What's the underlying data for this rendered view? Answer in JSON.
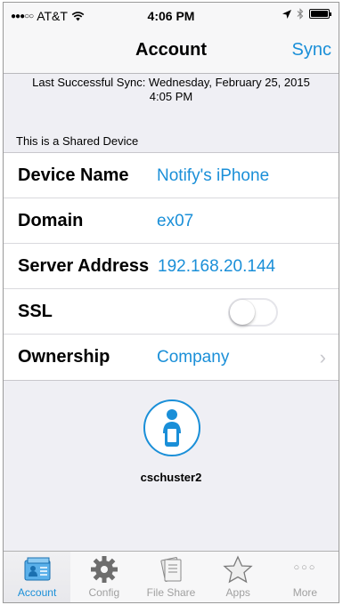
{
  "status_bar": {
    "signal": "●●●○○",
    "carrier": "AT&T",
    "time": "4:06 PM"
  },
  "nav": {
    "title": "Account",
    "sync_label": "Sync"
  },
  "sync_info": {
    "line1": "Last Successful Sync: Wednesday, February 25, 2015",
    "line2": "4:05 PM"
  },
  "shared_label": "This is a Shared Device",
  "form": {
    "device_name_label": "Device Name",
    "device_name_value": "Notify's iPhone",
    "domain_label": "Domain",
    "domain_value": "ex07",
    "server_label": "Server Address",
    "server_value": "192.168.20.144",
    "ssl_label": "SSL",
    "ssl_on": false,
    "ownership_label": "Ownership",
    "ownership_value": "Company"
  },
  "user": {
    "name": "cschuster2"
  },
  "tabs": [
    {
      "label": "Account",
      "icon": "account-icon",
      "active": true
    },
    {
      "label": "Config",
      "icon": "gear-icon",
      "active": false
    },
    {
      "label": "File Share",
      "icon": "file-share-icon",
      "active": false
    },
    {
      "label": "Apps",
      "icon": "star-icon",
      "active": false
    },
    {
      "label": "More",
      "icon": "more-icon",
      "active": false
    }
  ],
  "colors": {
    "accent": "#1a8fd8",
    "background": "#efeff4"
  }
}
